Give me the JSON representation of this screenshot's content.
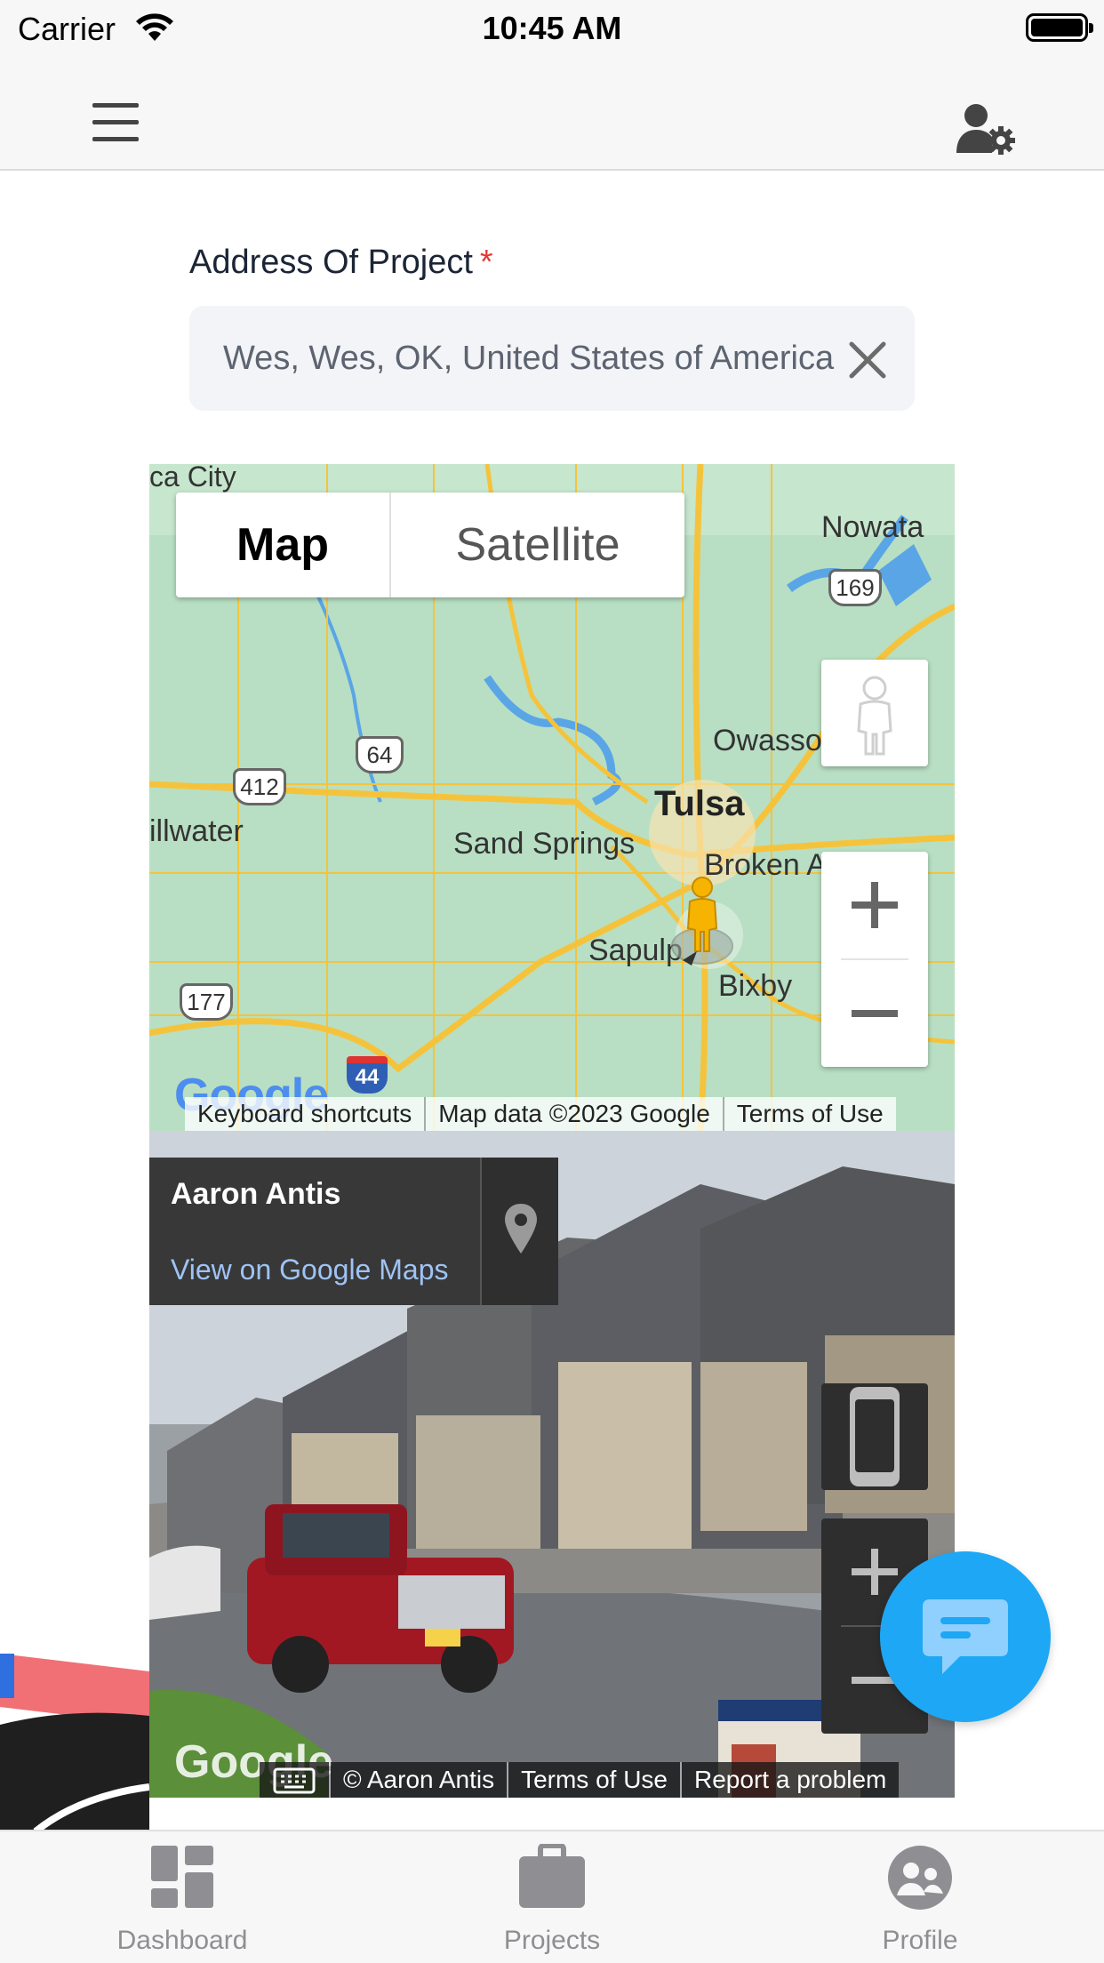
{
  "status_bar": {
    "carrier": "Carrier",
    "time": "10:45 AM"
  },
  "header": {
    "menu_icon": "hamburger-menu-icon",
    "settings_icon": "user-settings-icon"
  },
  "form": {
    "address_label": "Address Of Project",
    "required_marker": "*",
    "address_value": "Wes, Wes, OK, United States of America"
  },
  "map": {
    "type_map": "Map",
    "type_satellite": "Satellite",
    "places": {
      "nowata": "Nowata",
      "owasso": "Owasso",
      "tulsa": "Tulsa",
      "sand_springs": "Sand Springs",
      "broken_arrow": "Broken A",
      "stillwater": "illwater",
      "sapulpa": "Sapulp",
      "bixby": "Bixby",
      "ponca_city": "ca City"
    },
    "shields": {
      "us169": "169",
      "us64": "64",
      "us412": "412",
      "us177": "177",
      "i44": "44"
    },
    "footer": {
      "shortcuts": "Keyboard shortcuts",
      "data": "Map data ©2023 Google",
      "terms": "Terms of Use"
    },
    "logo": "Google"
  },
  "street_view": {
    "title": "Aaron Antis",
    "link": "View on Google Maps",
    "footer": {
      "copyright": "© Aaron Antis",
      "terms": "Terms of Use",
      "report": "Report a problem"
    },
    "logo": "Google"
  },
  "tabs": [
    {
      "label": "Dashboard",
      "icon": "dashboard-icon"
    },
    {
      "label": "Projects",
      "icon": "briefcase-icon"
    },
    {
      "label": "Profile",
      "icon": "profile-icon"
    }
  ],
  "colors": {
    "accent": "#1ea7f4",
    "required": "#e53935",
    "map_land": "#b8dfc3",
    "road": "#f5c33b"
  }
}
